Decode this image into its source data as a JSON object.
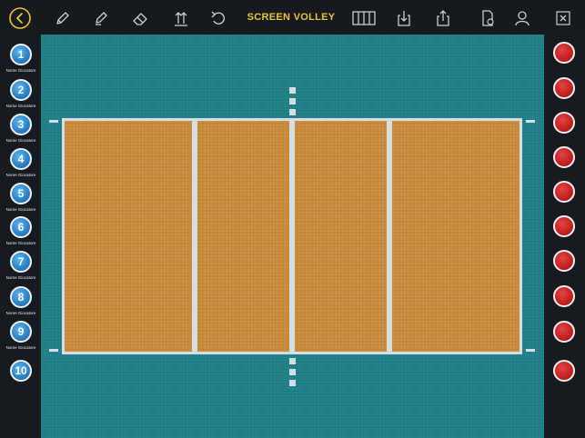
{
  "app": {
    "title": "SCREEN VOLLEY"
  },
  "toolbar": {
    "left_tools": [
      "back-icon",
      "pencil-icon",
      "marker-icon",
      "eraser-icon",
      "arrows-up-icon",
      "undo-icon"
    ],
    "right_tools": [
      "columns-icon",
      "download-icon",
      "share-icon",
      "document-icon",
      "users-icon",
      "close-icon"
    ]
  },
  "players": [
    {
      "number": "1",
      "name": "Nome Giocatore"
    },
    {
      "number": "2",
      "name": "Nome Giocatore"
    },
    {
      "number": "3",
      "name": "Nome Giocatore"
    },
    {
      "number": "4",
      "name": "Nome Giocatore"
    },
    {
      "number": "5",
      "name": "Nome Giocatore"
    },
    {
      "number": "6",
      "name": "Nome Giocatore"
    },
    {
      "number": "7",
      "name": "Nome Giocatore"
    },
    {
      "number": "8",
      "name": "Nome Giocatore"
    },
    {
      "number": "9",
      "name": "Nome Giocatore"
    },
    {
      "number": "10",
      "name": ""
    }
  ],
  "opponents_count": 10,
  "colors": {
    "title": "#e9c53a",
    "player": "#2b7fc4",
    "opponent": "#c41f1f",
    "field": "#1f7f87",
    "court": "#c98a3c",
    "lines": "#d5dee3"
  }
}
